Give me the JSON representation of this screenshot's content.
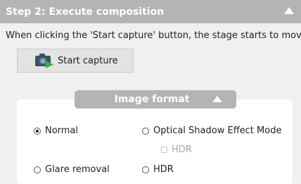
{
  "header": {
    "title": "Step 2: Execute composition"
  },
  "description": "When clicking the 'Start capture' button, the stage starts to move.",
  "start_button": {
    "label": "Start capture",
    "icon": "camera-play-icon"
  },
  "image_format": {
    "title": "Image format",
    "options": {
      "normal": {
        "label": "Normal",
        "selected": true
      },
      "optical_shadow": {
        "label": "Optical Shadow Effect Mode",
        "selected": false
      },
      "hdr_sub": {
        "label": "HDR",
        "checked": false,
        "enabled": false
      },
      "glare_removal": {
        "label": "Glare removal",
        "selected": false
      },
      "hdr": {
        "label": "HDR",
        "selected": false
      }
    }
  },
  "colors": {
    "header_bg": "#b4b4b4",
    "panel_bg": "#f0f0f0",
    "camera_play_accent": "#2fb34a"
  }
}
